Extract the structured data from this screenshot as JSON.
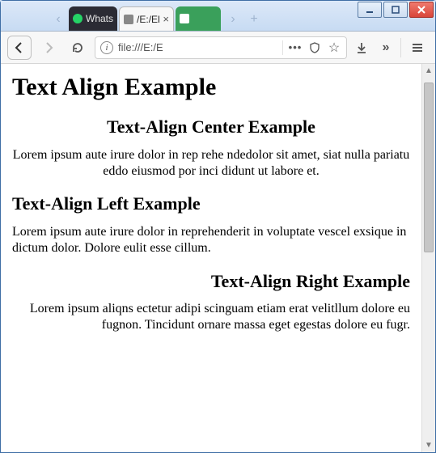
{
  "window": {
    "minimize_tooltip": "Minimize",
    "maximize_tooltip": "Maximize",
    "close_tooltip": "Close"
  },
  "tabs": {
    "scroll_left": "‹",
    "scroll_right": "›",
    "new_tab": "+",
    "items": [
      {
        "label": "Whats"
      },
      {
        "label": "/E:/Ele"
      },
      {
        "label": ""
      }
    ],
    "close_x": "×"
  },
  "toolbar": {
    "back": "Back",
    "forward": "Forward",
    "reload": "Reload",
    "info": "i",
    "url": "file:///E:/E",
    "menu_dots": "•••",
    "shield": "shield",
    "star": "☆",
    "download": "↓",
    "overflow": "»",
    "menu": "≡"
  },
  "content": {
    "h1": "Text Align Example",
    "sections": [
      {
        "heading": "Text-Align Center Example",
        "body": "Lorem ipsum aute irure dolor in rep rehe ndedolor sit amet, siat nulla pariatu eddo eiusmod por inci didunt ut labore et."
      },
      {
        "heading": "Text-Align Left Example",
        "body": "Lorem ipsum aute irure dolor in reprehenderit in voluptate vescel exsique in dictum dolor. Dolore eulit esse cillum."
      },
      {
        "heading": "Text-Align Right Example",
        "body": "Lorem ipsum aliqns ectetur adipi scinguam etiam erat velitllum dolore eu fugnon. Tincidunt ornare massa eget egestas dolore eu fugr."
      }
    ]
  }
}
